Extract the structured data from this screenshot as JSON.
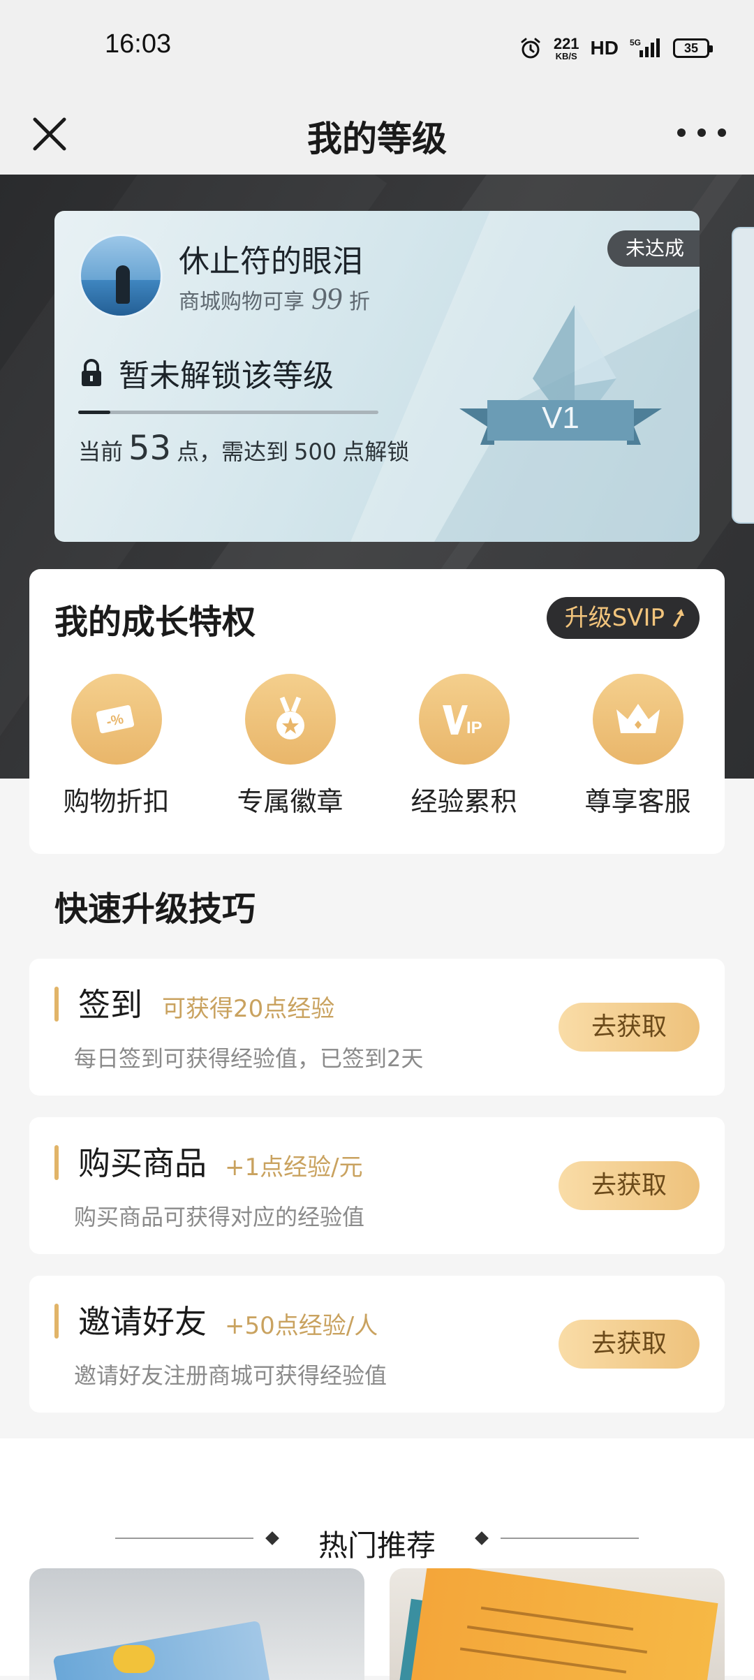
{
  "status_bar": {
    "time": "16:03",
    "net_speed": "221",
    "net_unit": "KB/S",
    "hd": "HD",
    "network": "5G",
    "battery": "35"
  },
  "nav": {
    "title": "我的等级",
    "close_icon": "close-icon",
    "more_icon": "more-icon"
  },
  "level_card": {
    "username": "休止符的眼泪",
    "discount_prefix": "商城购物可享",
    "discount_value": "99",
    "discount_suffix": "折",
    "status_badge": "未达成",
    "lock_text": "暂未解锁该等级",
    "progress_fraction": 0.106,
    "points_prefix": "当前",
    "points_current": "53",
    "points_middle": "点，需达到",
    "points_target": "500",
    "points_suffix": "点解锁",
    "level_label": "V1"
  },
  "privileges": {
    "title": "我的成长特权",
    "svip_button": "升级SVIP",
    "items": [
      {
        "label": "购物折扣",
        "icon": "discount-coupon-icon"
      },
      {
        "label": "专属徽章",
        "icon": "medal-icon"
      },
      {
        "label": "经验累积",
        "icon": "vip-icon"
      },
      {
        "label": "尊享客服",
        "icon": "crown-icon"
      }
    ]
  },
  "tips": {
    "title": "快速升级技巧",
    "items": [
      {
        "name": "签到",
        "reward": "可获得20点经验",
        "desc": "每日签到可获得经验值，已签到2天",
        "button": "去获取"
      },
      {
        "name": "购买商品",
        "reward": "+1点经验/元",
        "desc": "购买商品可获得对应的经验值",
        "button": "去获取"
      },
      {
        "name": "邀请好友",
        "reward": "+50点经验/人",
        "desc": "邀请好友注册商城可获得经验值",
        "button": "去获取"
      }
    ]
  },
  "hot": {
    "title": "热门推荐"
  },
  "colors": {
    "accent_gold": "#e9b66a",
    "dark_band": "#2e2f31",
    "reward_text": "#c9a25f"
  }
}
